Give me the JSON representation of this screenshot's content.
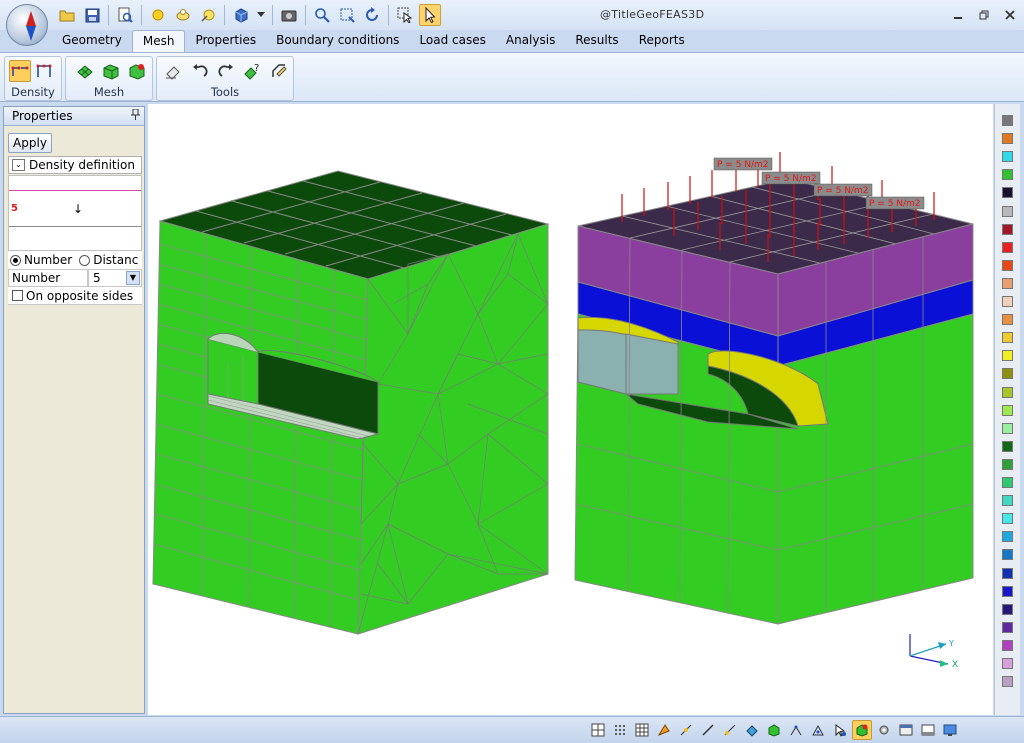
{
  "window": {
    "title": "@TitleGeoFEAS3D"
  },
  "tabs": [
    {
      "label": "Geometry"
    },
    {
      "label": "Mesh",
      "active": true
    },
    {
      "label": "Properties"
    },
    {
      "label": "Boundary conditions"
    },
    {
      "label": "Load cases"
    },
    {
      "label": "Analysis"
    },
    {
      "label": "Results"
    },
    {
      "label": "Reports"
    }
  ],
  "ribbon": {
    "groups": [
      {
        "label": "Density"
      },
      {
        "label": "Mesh"
      },
      {
        "label": "Tools"
      }
    ]
  },
  "panel": {
    "title": "Properties",
    "apply_label": "Apply",
    "density_definition_label": "Density definition",
    "preview_value": "5",
    "radio_number_label": "Number",
    "radio_distance_label": "Distanc",
    "number_label": "Number",
    "number_value": "5",
    "opposite_sides_label": "On opposite sides"
  },
  "viewport": {
    "load_labels": [
      "P = 5 N/m2",
      "P = 5 N/m2",
      "P = 5 N/m2",
      "P = 5 N/m2"
    ],
    "axis_labels": {
      "y": "Y",
      "x": "X"
    }
  },
  "colors": {
    "mesh_green": "#33cc22",
    "mesh_dark_green": "#0b4a0b",
    "layer_purple": "#8a3e9e",
    "layer_top_dark": "#3c2a4a",
    "layer_blue": "#0a10d6",
    "liner_yellow": "#d6d600",
    "load_red": "#d01010"
  },
  "palette": [
    "#777777",
    "#e07820",
    "#30d8e8",
    "#30c030",
    "#1a1030",
    "#b8b8b8",
    "#a01828",
    "#e82020",
    "#e84818",
    "#e8a070",
    "#f0d0b8",
    "#e89040",
    "#f0c830",
    "#f0f020",
    "#909010",
    "#a8c828",
    "#a0e850",
    "#98f0a0",
    "#106818",
    "#30a038",
    "#30c870",
    "#40d8c0",
    "#48e8e8",
    "#20a8e0",
    "#1878c8",
    "#1030b0",
    "#1818c8",
    "#281878",
    "#6028a0",
    "#b040c0",
    "#d8a0d8",
    "#b8a0c0"
  ]
}
